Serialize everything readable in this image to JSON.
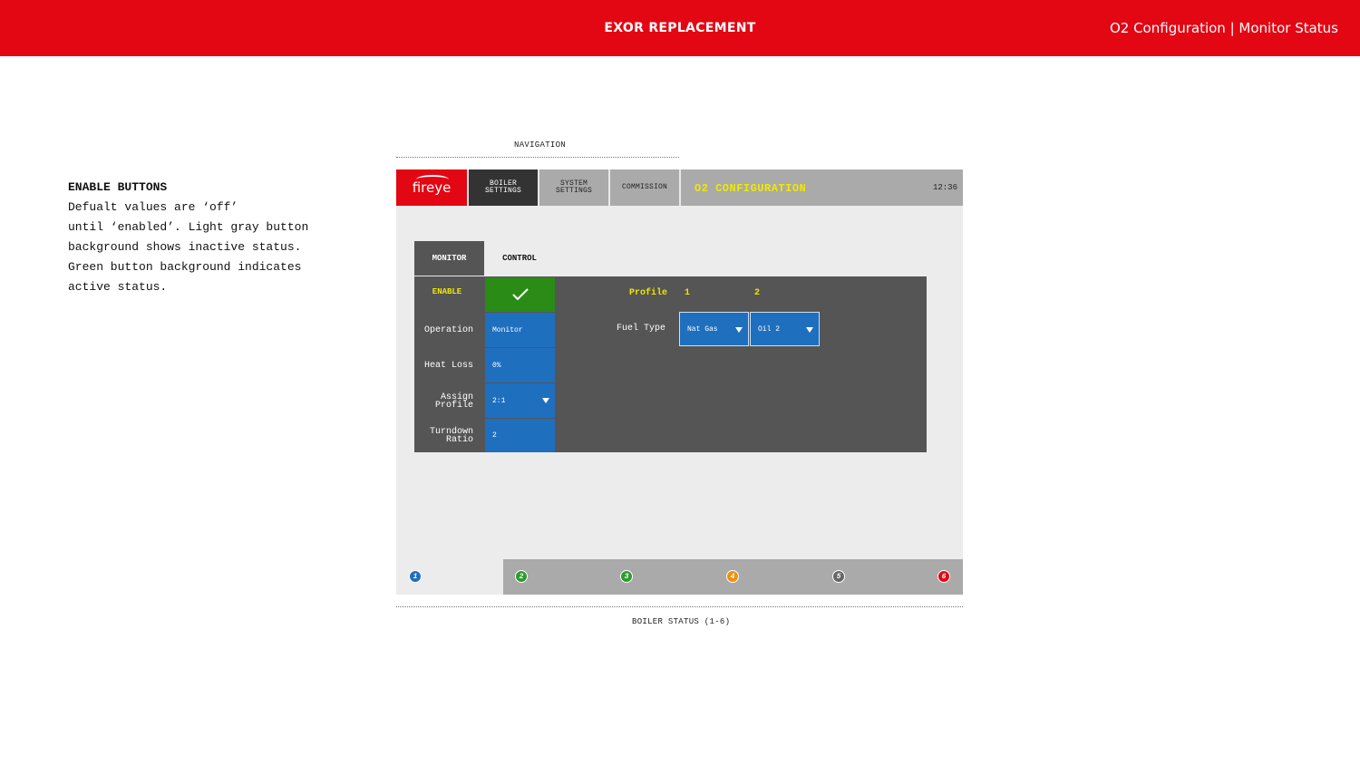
{
  "banner": {
    "title": "EXOR REPLACEMENT",
    "subtitle": "O2 Configuration | Monitor Status"
  },
  "note": {
    "title": "ENABLE BUTTONS",
    "lines": [
      "Defualt values are ‘off’",
      "until ‘enabled’. Light gray button",
      "background shows inactive status.",
      "Green button background indicates",
      "active status."
    ]
  },
  "annotations": {
    "navigation": "NAVIGATION",
    "boiler_status": "BOILER STATUS (1-6)"
  },
  "header": {
    "logo": "fireye",
    "nav": {
      "boiler_line1": "BOILER",
      "boiler_line2": "SETTINGS",
      "system_line1": "SYSTEM",
      "system_line2": "SETTINGS",
      "commission": "COMMISSION"
    },
    "title": "O2 CONFIGURATION",
    "clock": "12:36"
  },
  "tabs": {
    "monitor": "MONITOR",
    "control": "CONTROL"
  },
  "rows": {
    "enable": "ENABLE",
    "operation_label": "Operation",
    "operation_value": "Monitor",
    "heat_loss_label": "Heat Loss",
    "heat_loss_value": "0%",
    "assign_line1": "Assign",
    "assign_line2": "Profile",
    "assign_value": "2:1",
    "turndown_line1": "Turndown",
    "turndown_line2": "Ratio",
    "turndown_value": "2"
  },
  "profile": {
    "label": "Profile",
    "col1": "1",
    "col2": "2",
    "fuel_type_label": "Fuel Type",
    "fuel1": "Nat Gas",
    "fuel2": "Oil 2"
  },
  "status": {
    "boilers": [
      "1",
      "2",
      "3",
      "4",
      "5",
      "6"
    ]
  },
  "colors": {
    "brand_red": "#e30613",
    "accent_yellow": "#f0e800",
    "active_green": "#2a8c16",
    "field_blue": "#1f6fbf",
    "boiler_colors": [
      "#1f6fbf",
      "#2e9b2e",
      "#2e9b2e",
      "#f0900a",
      "#666666",
      "#e30613"
    ]
  }
}
